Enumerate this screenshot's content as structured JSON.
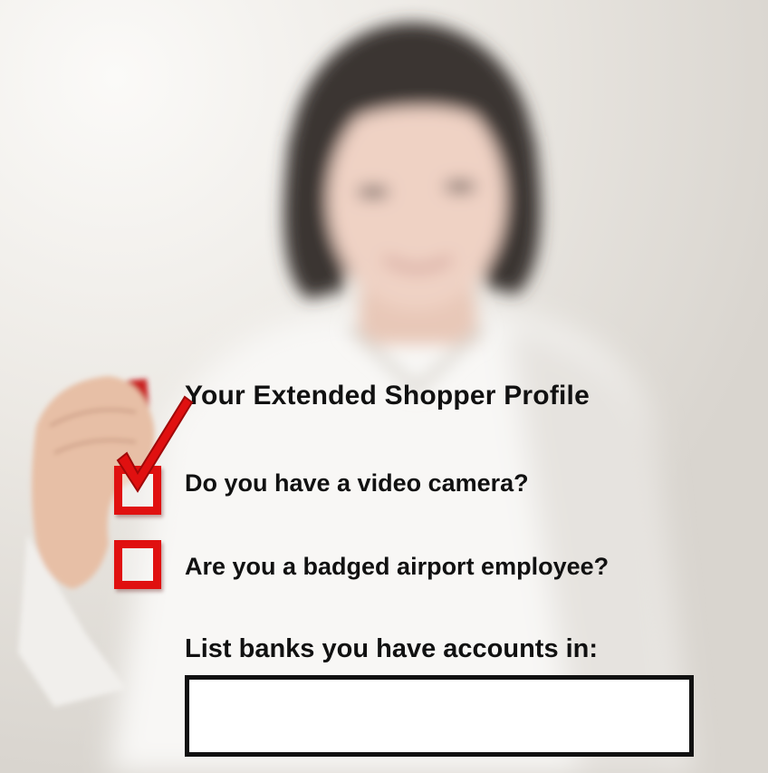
{
  "profile": {
    "title": "Your Extended Shopper Profile",
    "questions": [
      {
        "label": "Do you have a video camera?",
        "checked": true
      },
      {
        "label": "Are you a badged airport employee?",
        "checked": false
      }
    ],
    "banks_label": "List banks you have accounts in:",
    "banks_value": ""
  },
  "colors": {
    "checkbox": "#e01010",
    "text": "#111111",
    "background": "#e9e6e1"
  }
}
